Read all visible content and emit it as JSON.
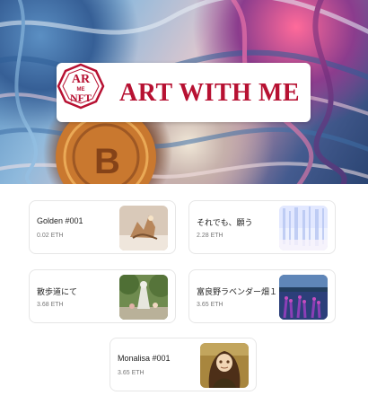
{
  "brand": {
    "logo_monogram": "ART ME NFT",
    "title": "ART WITH ME",
    "accent_color": "#b71132"
  },
  "hero": {
    "icons": [
      "bitcoin-coin-art"
    ]
  },
  "items": [
    {
      "title": "Golden #001",
      "price": "0.02 ETH",
      "thumb": "golden-sculpture-art"
    },
    {
      "title": "それでも、願う",
      "price": "2.28 ETH",
      "thumb": "pastel-abstract-art"
    },
    {
      "title": "散歩道にて",
      "price": "3.68 ETH",
      "thumb": "garden-statue-art"
    },
    {
      "title": "富良野ラベンダー畑１",
      "price": "3.65 ETH",
      "thumb": "lavender-field-art"
    },
    {
      "title": "Monalisa #001",
      "price": "3.65 ETH",
      "thumb": "monalisa-anime-art"
    }
  ]
}
